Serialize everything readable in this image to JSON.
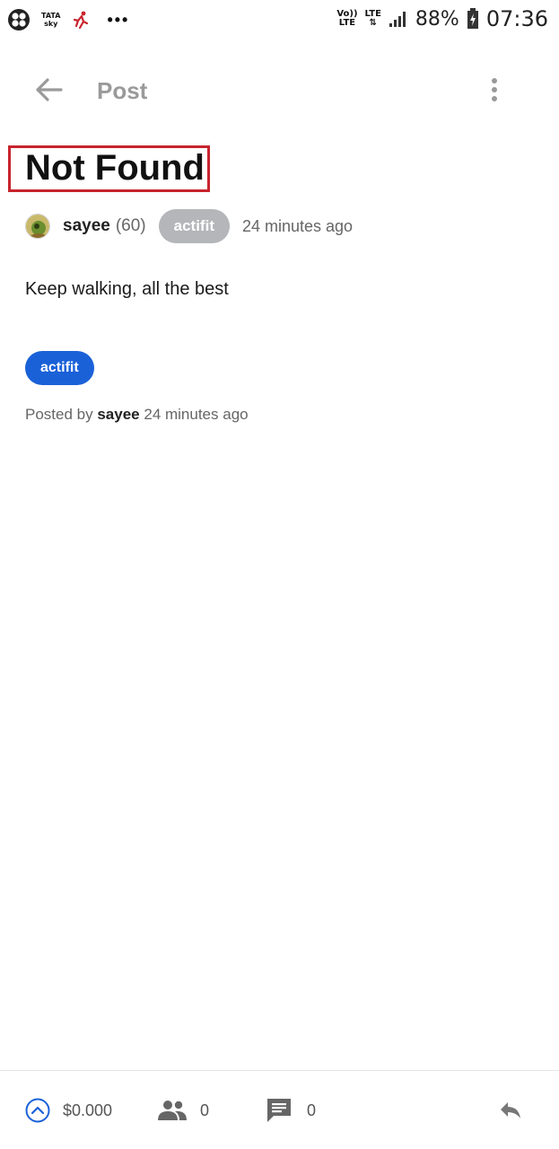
{
  "status_bar": {
    "left_icons": [
      "app-icon",
      "tatasky-icon",
      "runner-icon",
      "more-notifications-icon"
    ],
    "tatasky_line1": "TATA",
    "tatasky_line2": "sky",
    "dots": "•••",
    "volte_line1": "Vo))",
    "volte_line2": "LTE",
    "lte_label": "LTE",
    "battery_pct": "88%",
    "time": "07:36"
  },
  "header": {
    "title": "Post",
    "back_icon": "arrow-left-icon",
    "menu_icon": "more-vertical-icon"
  },
  "post": {
    "title": "Not Found",
    "author": "sayee",
    "reputation": "(60)",
    "community": "actifit",
    "time_ago": "24 minutes ago",
    "body": "Keep walking, all the best",
    "tag": "actifit",
    "posted_by_prefix": "Posted by",
    "posted_by_author": "sayee",
    "posted_by_time": "24 minutes ago"
  },
  "bottom_bar": {
    "payout": "$0.000",
    "voters_count": "0",
    "comments_count": "0",
    "icons": [
      "upvote-icon",
      "people-icon",
      "comment-icon",
      "reply-icon"
    ]
  },
  "colors": {
    "highlight_box": "#c8242d",
    "tag_blue": "#1a61d8",
    "community_gray": "#b4b6b9",
    "header_gray": "#9a9a9a"
  }
}
